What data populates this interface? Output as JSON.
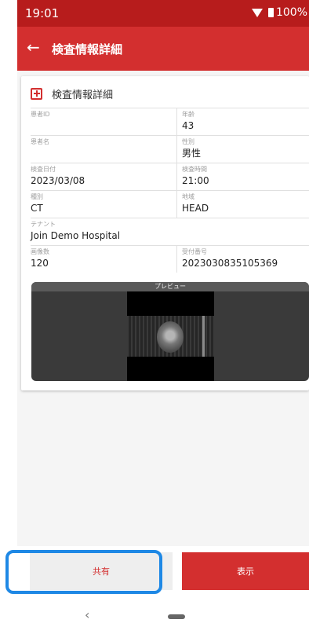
{
  "status": {
    "time": "19:01",
    "battery": "100%"
  },
  "appbar": {
    "title": "検査情報詳細"
  },
  "card": {
    "title": "検査情報詳細",
    "rows": [
      {
        "left": {
          "label": "患者ID",
          "value": ""
        },
        "right": {
          "label": "年齢",
          "value": "43"
        }
      },
      {
        "left": {
          "label": "患者名",
          "value": ""
        },
        "right": {
          "label": "性別",
          "value": "男性"
        }
      },
      {
        "left": {
          "label": "検査日付",
          "value": "2023/03/08"
        },
        "right": {
          "label": "検査時間",
          "value": "21:00"
        }
      },
      {
        "left": {
          "label": "種別",
          "value": "CT"
        },
        "right": {
          "label": "地域",
          "value": "HEAD"
        }
      },
      {
        "full": {
          "label": "テナント",
          "value": "Join Demo Hospital"
        }
      },
      {
        "left": {
          "label": "画像数",
          "value": "120"
        },
        "right": {
          "label": "受付番号",
          "value": "2023030835105369"
        }
      }
    ],
    "preview_label": "プレビュー"
  },
  "buttons": {
    "share": "共有",
    "show": "表示"
  },
  "nav": {
    "back_glyph": "‹"
  },
  "colors": {
    "primary": "#d32f2f",
    "statusbar": "#b71c1c",
    "highlight": "#1e88e5"
  }
}
